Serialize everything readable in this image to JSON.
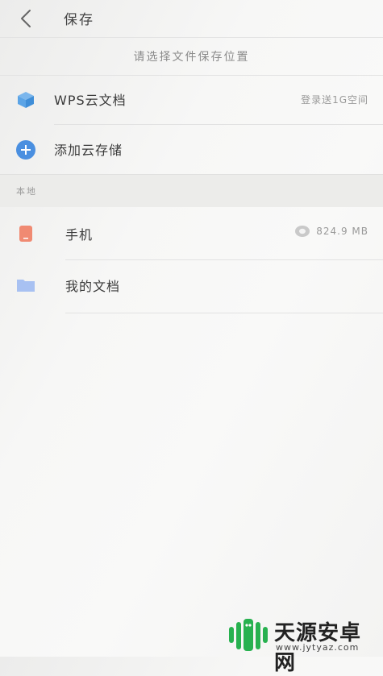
{
  "header": {
    "title": "保存"
  },
  "subtitle": "请选择文件保存位置",
  "cloud": {
    "wps": {
      "label": "WPS云文档",
      "hint": "登录送1G空间"
    },
    "add": {
      "label": "添加云存储"
    }
  },
  "local": {
    "section_label": "本地",
    "phone": {
      "label": "手机",
      "storage": "824.9 MB"
    },
    "docs": {
      "label": "我的文档"
    }
  },
  "watermark": {
    "title": "天源安卓网",
    "url": "www.jytyaz.com"
  },
  "colors": {
    "wps_icon": "#5ba4e6",
    "add_icon": "#4a8fe0",
    "phone_icon": "#f08a72",
    "folder_icon": "#a8c1f2",
    "watermark_green": "#27b14f"
  },
  "icons": [
    "back-arrow-icon",
    "cube-icon",
    "plus-circle-icon",
    "phone-icon",
    "disk-icon",
    "folder-icon",
    "android-logo-icon"
  ]
}
